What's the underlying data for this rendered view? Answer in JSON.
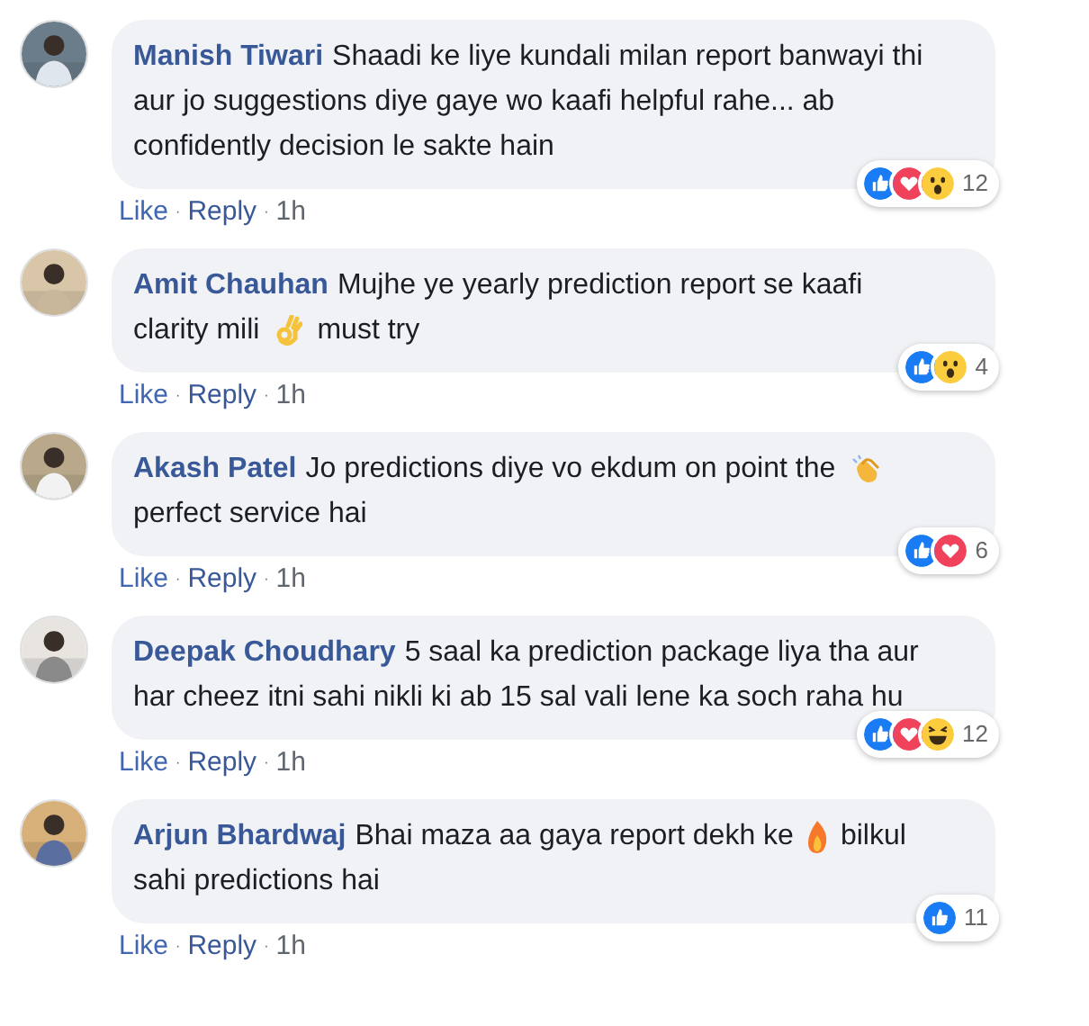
{
  "comments": [
    {
      "author": "Manish Tiwari",
      "parts": [
        {
          "kind": "text",
          "text": "Shaadi ke liye kundali milan report banwayi thi aur jo suggestions diye gaye wo kaafi helpful rahe... ab confidently decision le sakte hain"
        }
      ],
      "reactions": [
        {
          "kind": "like"
        },
        {
          "kind": "love"
        },
        {
          "kind": "wow"
        }
      ],
      "reaction_count": "12",
      "actions": [
        "Like",
        "Reply"
      ],
      "separator": "·",
      "time": "1h"
    },
    {
      "author": "Amit Chauhan",
      "parts": [
        {
          "kind": "text",
          "text": "Mujhe ye yearly prediction report se kaafi clarity mili"
        },
        {
          "kind": "ok_hand"
        },
        {
          "kind": "text",
          "text": "must try"
        }
      ],
      "reactions": [
        {
          "kind": "like"
        },
        {
          "kind": "wow"
        }
      ],
      "reaction_count": "4",
      "actions": [
        "Like",
        "Reply"
      ],
      "separator": "·",
      "time": "1h"
    },
    {
      "author": "Akash Patel",
      "parts": [
        {
          "kind": "text",
          "text": "Jo predictions diye vo ekdum on point the"
        },
        {
          "kind": "clap"
        },
        {
          "kind": "text",
          "text": "perfect service hai"
        }
      ],
      "reactions": [
        {
          "kind": "like"
        },
        {
          "kind": "love"
        }
      ],
      "reaction_count": "6",
      "actions": [
        "Like",
        "Reply"
      ],
      "separator": "·",
      "time": "1h"
    },
    {
      "author": "Deepak Choudhary",
      "parts": [
        {
          "kind": "text",
          "text": "5 saal ka prediction package liya tha aur har cheez itni sahi nikli ki ab 15 sal vali lene ka soch raha hu"
        }
      ],
      "reactions": [
        {
          "kind": "like"
        },
        {
          "kind": "love"
        },
        {
          "kind": "haha"
        }
      ],
      "reaction_count": "12",
      "actions": [
        "Like",
        "Reply"
      ],
      "separator": "·",
      "time": "1h"
    },
    {
      "author": "Arjun Bhardwaj",
      "parts": [
        {
          "kind": "text",
          "text": "Bhai maza aa gaya report dekh ke"
        },
        {
          "kind": "fire"
        },
        {
          "kind": "text",
          "text": "bilkul sahi predictions hai"
        }
      ],
      "reactions": [
        {
          "kind": "like"
        }
      ],
      "reaction_count": "11",
      "actions": [
        "Like",
        "Reply"
      ],
      "separator": "·",
      "time": "1h"
    }
  ]
}
